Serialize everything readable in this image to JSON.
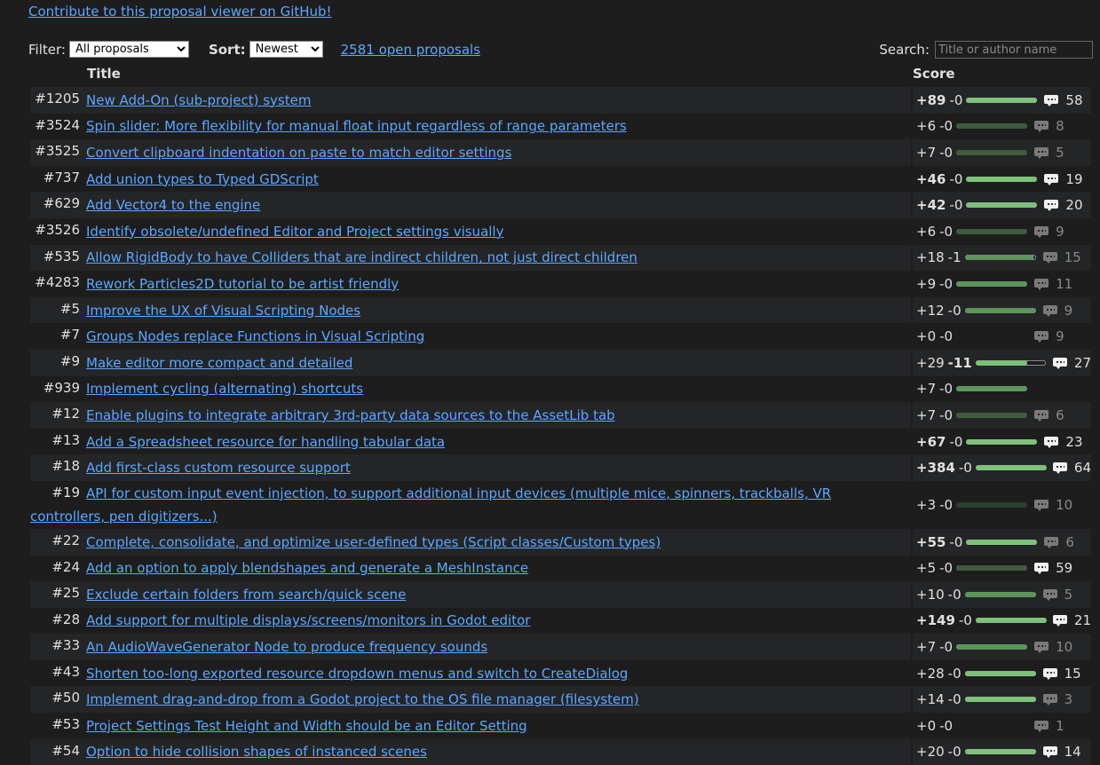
{
  "header": {
    "github_link": "Contribute to this proposal viewer on GitHub!",
    "filter_label": "Filter:",
    "filter_value": "All proposals",
    "sort_label": "Sort:",
    "sort_value": "Newest",
    "open_count": "2581 open proposals",
    "search_label": "Search:",
    "search_placeholder": "Title or author name"
  },
  "table": {
    "col_title": "Title",
    "col_score": "Score"
  },
  "colors": {
    "link": "#5ca8ff",
    "bar_green_bright": "#7fc07a",
    "bar_green_mid": "#5e955c",
    "bar_green_dim": "#3f5c3e",
    "comment_bright": "#f0f0f0",
    "comment_dim": "#7a7a7a"
  },
  "rows": [
    {
      "num": "#1205",
      "title": "New Add-On (sub-project) system",
      "pos": "+89",
      "neg": "-0",
      "pos_bold": true,
      "neg_bold": false,
      "score_fraction": 1.0,
      "neg_fraction": 0,
      "bar_tone": "bright",
      "comments": "58",
      "comments_bright": true
    },
    {
      "num": "#3524",
      "title": "Spin slider: More flexibility for manual float input regardless of range parameters",
      "pos": "+6",
      "neg": "-0",
      "pos_bold": false,
      "neg_bold": false,
      "score_fraction": 1.0,
      "neg_fraction": 0,
      "bar_tone": "dim",
      "comments": "8",
      "comments_bright": false
    },
    {
      "num": "#3525",
      "title": "Convert clipboard indentation on paste to match editor settings",
      "pos": "+7",
      "neg": "-0",
      "pos_bold": false,
      "neg_bold": false,
      "score_fraction": 1.0,
      "neg_fraction": 0,
      "bar_tone": "dim",
      "comments": "5",
      "comments_bright": false
    },
    {
      "num": "#737",
      "title": "Add union types to Typed GDScript",
      "pos": "+46",
      "neg": "-0",
      "pos_bold": true,
      "neg_bold": false,
      "score_fraction": 1.0,
      "neg_fraction": 0,
      "bar_tone": "bright",
      "comments": "19",
      "comments_bright": true
    },
    {
      "num": "#629",
      "title": "Add Vector4 to the engine",
      "pos": "+42",
      "neg": "-0",
      "pos_bold": true,
      "neg_bold": false,
      "score_fraction": 1.0,
      "neg_fraction": 0,
      "bar_tone": "bright",
      "comments": "20",
      "comments_bright": true
    },
    {
      "num": "#3526",
      "title": "Identify obsolete/undefined Editor and Project settings visually",
      "pos": "+6",
      "neg": "-0",
      "pos_bold": false,
      "neg_bold": false,
      "score_fraction": 1.0,
      "neg_fraction": 0,
      "bar_tone": "dim",
      "comments": "9",
      "comments_bright": false
    },
    {
      "num": "#535",
      "title": "Allow RigidBody to have Colliders that are indirect children, not just direct children",
      "pos": "+18",
      "neg": "-1",
      "pos_bold": false,
      "neg_bold": false,
      "score_fraction": 0.95,
      "neg_fraction": 0.05,
      "bar_tone": "mid",
      "comments": "15",
      "comments_bright": false
    },
    {
      "num": "#4283",
      "title": "Rework Particles2D tutorial to be artist friendly",
      "pos": "+9",
      "neg": "-0",
      "pos_bold": false,
      "neg_bold": false,
      "score_fraction": 1.0,
      "neg_fraction": 0,
      "bar_tone": "mid",
      "comments": "11",
      "comments_bright": false
    },
    {
      "num": "#5",
      "title": "Improve the UX of Visual Scripting Nodes",
      "pos": "+12",
      "neg": "-0",
      "pos_bold": false,
      "neg_bold": false,
      "score_fraction": 1.0,
      "neg_fraction": 0,
      "bar_tone": "mid",
      "comments": "9",
      "comments_bright": false
    },
    {
      "num": "#7",
      "title": "Groups Nodes replace Functions in Visual Scripting",
      "pos": "+0",
      "neg": "-0",
      "pos_bold": false,
      "neg_bold": false,
      "score_fraction": 0,
      "neg_fraction": 0,
      "bar_tone": "none",
      "comments": "9",
      "comments_bright": false
    },
    {
      "num": "#9",
      "title": "Make editor more compact and detailed",
      "pos": "+29",
      "neg": "-11",
      "pos_bold": false,
      "neg_bold": true,
      "score_fraction": 0.72,
      "neg_fraction": 0.28,
      "bar_tone": "bright",
      "comments": "27",
      "comments_bright": true
    },
    {
      "num": "#939",
      "title": "Implement cycling (alternating) shortcuts",
      "pos": "+7",
      "neg": "-0",
      "pos_bold": false,
      "neg_bold": false,
      "score_fraction": 1.0,
      "neg_fraction": 0,
      "bar_tone": "mid",
      "comments": "",
      "comments_bright": false
    },
    {
      "num": "#12",
      "title": "Enable plugins to integrate arbitrary 3rd-party data sources to the AssetLib tab",
      "pos": "+7",
      "neg": "-0",
      "pos_bold": false,
      "neg_bold": false,
      "score_fraction": 1.0,
      "neg_fraction": 0,
      "bar_tone": "dim",
      "comments": "6",
      "comments_bright": false
    },
    {
      "num": "#13",
      "title": "Add a Spreadsheet resource for handling tabular data",
      "pos": "+67",
      "neg": "-0",
      "pos_bold": true,
      "neg_bold": false,
      "score_fraction": 1.0,
      "neg_fraction": 0,
      "bar_tone": "bright",
      "comments": "23",
      "comments_bright": true
    },
    {
      "num": "#18",
      "title": "Add first-class custom resource support",
      "pos": "+384",
      "neg": "-0",
      "pos_bold": true,
      "neg_bold": false,
      "score_fraction": 1.0,
      "neg_fraction": 0,
      "bar_tone": "bright",
      "comments": "64",
      "comments_bright": true
    },
    {
      "num": "#19",
      "title": "API for custom input event injection, to support additional input devices (multiple mice, spinners, trackballs, VR controllers, pen digitizers...)",
      "pos": "+3",
      "neg": "-0",
      "pos_bold": false,
      "neg_bold": false,
      "score_fraction": 1.0,
      "neg_fraction": 0,
      "bar_tone": "faint",
      "comments": "10",
      "comments_bright": false,
      "tall": true
    },
    {
      "num": "#22",
      "title": "Complete, consolidate, and optimize user-defined types (Script classes/Custom types)",
      "pos": "+55",
      "neg": "-0",
      "pos_bold": true,
      "neg_bold": false,
      "score_fraction": 1.0,
      "neg_fraction": 0,
      "bar_tone": "bright",
      "comments": "6",
      "comments_bright": false
    },
    {
      "num": "#24",
      "title": "Add an option to apply blendshapes and generate a MeshInstance",
      "pos": "+5",
      "neg": "-0",
      "pos_bold": false,
      "neg_bold": false,
      "score_fraction": 1.0,
      "neg_fraction": 0,
      "bar_tone": "dim",
      "comments": "59",
      "comments_bright": true
    },
    {
      "num": "#25",
      "title": "Exclude certain folders from search/quick scene",
      "pos": "+10",
      "neg": "-0",
      "pos_bold": false,
      "neg_bold": false,
      "score_fraction": 1.0,
      "neg_fraction": 0,
      "bar_tone": "mid",
      "comments": "5",
      "comments_bright": false
    },
    {
      "num": "#28",
      "title": "Add support for multiple displays/screens/monitors in Godot editor",
      "pos": "+149",
      "neg": "-0",
      "pos_bold": true,
      "neg_bold": false,
      "score_fraction": 1.0,
      "neg_fraction": 0,
      "bar_tone": "bright",
      "comments": "21",
      "comments_bright": true
    },
    {
      "num": "#33",
      "title": "An AudioWaveGenerator Node to produce frequency sounds",
      "pos": "+7",
      "neg": "-0",
      "pos_bold": false,
      "neg_bold": false,
      "score_fraction": 1.0,
      "neg_fraction": 0,
      "bar_tone": "mid",
      "comments": "10",
      "comments_bright": false
    },
    {
      "num": "#43",
      "title": "Shorten too-long exported resource dropdown menus and switch to CreateDialog",
      "pos": "+28",
      "neg": "-0",
      "pos_bold": false,
      "neg_bold": false,
      "score_fraction": 1.0,
      "neg_fraction": 0,
      "bar_tone": "bright",
      "comments": "15",
      "comments_bright": true
    },
    {
      "num": "#50",
      "title": "Implement drag-and-drop from a Godot project to the OS file manager (filesystem)",
      "pos": "+14",
      "neg": "-0",
      "pos_bold": false,
      "neg_bold": false,
      "score_fraction": 1.0,
      "neg_fraction": 0,
      "bar_tone": "bright",
      "comments": "3",
      "comments_bright": false
    },
    {
      "num": "#53",
      "title": "Project Settings Test Height and Width should be an Editor Setting",
      "pos": "+0",
      "neg": "-0",
      "pos_bold": false,
      "neg_bold": false,
      "score_fraction": 0,
      "neg_fraction": 0,
      "bar_tone": "none",
      "comments": "1",
      "comments_bright": false
    },
    {
      "num": "#54",
      "title": "Option to hide collision shapes of instanced scenes",
      "pos": "+20",
      "neg": "-0",
      "pos_bold": false,
      "neg_bold": false,
      "score_fraction": 1.0,
      "neg_fraction": 0,
      "bar_tone": "bright",
      "comments": "14",
      "comments_bright": true
    }
  ]
}
